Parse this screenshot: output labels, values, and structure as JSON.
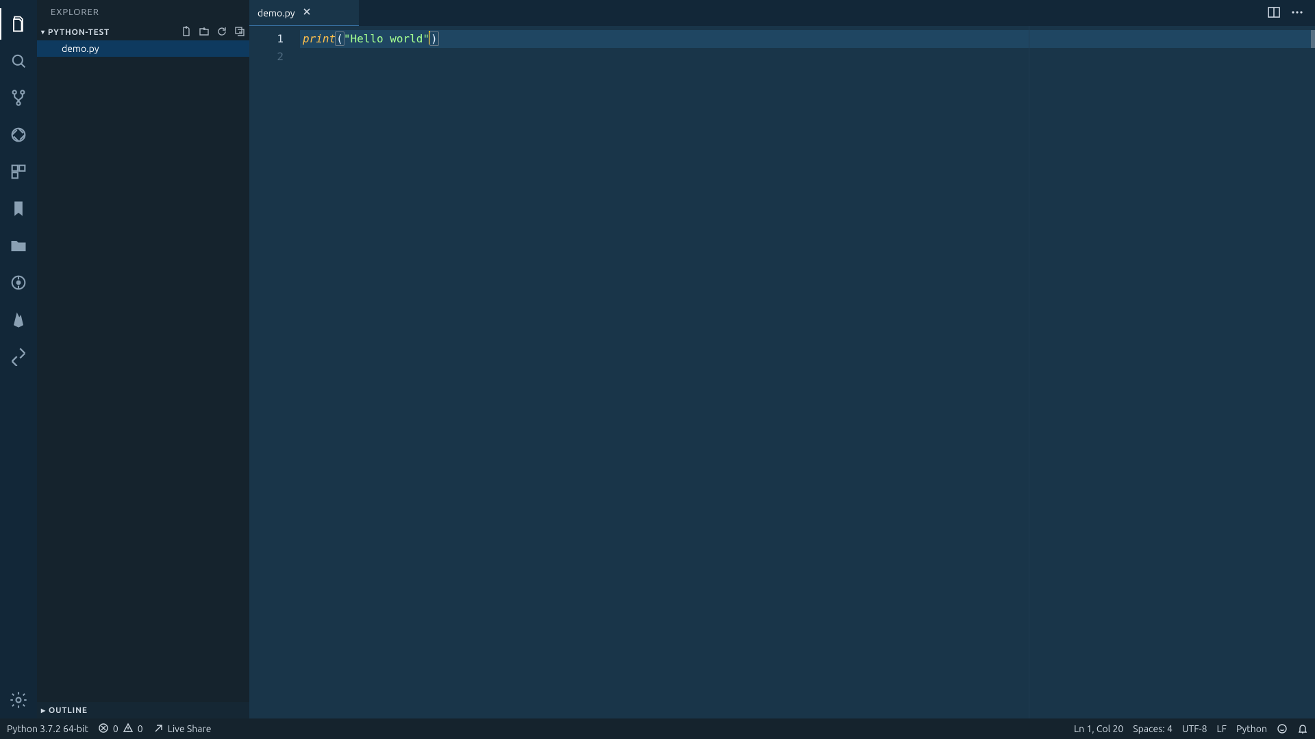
{
  "sidebar": {
    "title": "EXPLORER",
    "project": "PYTHON-TEST",
    "files": [
      "demo.py"
    ],
    "outline": "OUTLINE"
  },
  "tabs": {
    "open": [
      "demo.py"
    ]
  },
  "editor": {
    "lines": [
      "1",
      "2"
    ],
    "code": {
      "func": "print",
      "open": "(",
      "str": "\"Hello world\"",
      "close": ")"
    },
    "ruler_cols": 110
  },
  "status": {
    "python": "Python 3.7.2 64-bit",
    "errors": "0",
    "warnings": "0",
    "liveshare": "Live Share",
    "lncol": "Ln 1, Col 20",
    "spaces": "Spaces: 4",
    "encoding": "UTF-8",
    "eol": "LF",
    "lang": "Python"
  }
}
